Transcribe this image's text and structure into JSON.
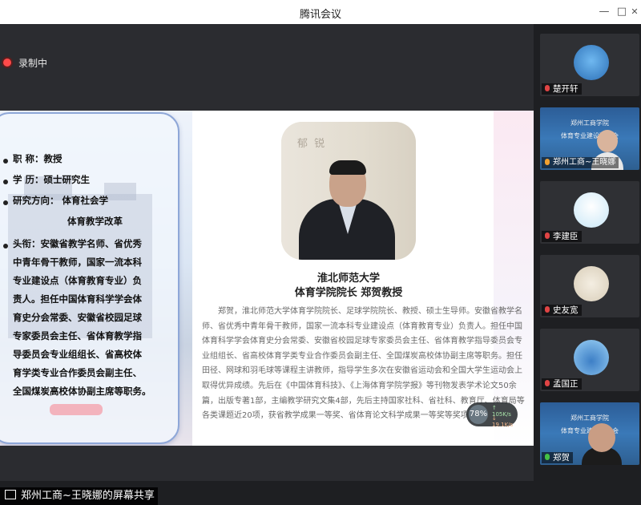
{
  "app": {
    "window_title": "腾讯会议"
  },
  "window_controls": {
    "minimize": "—",
    "maximize": "□",
    "close": "✕"
  },
  "recording": {
    "label": "录制中"
  },
  "slide": {
    "left_card": {
      "title_line": "职 称：教授",
      "degree_line": "学 历：硕士研究生",
      "research_line1": "研究方向：  体育社会学",
      "research_line2": "体育教学改革",
      "honors": [
        "头衔：安徽省教学名师、省优秀",
        "中青年骨干教师，国家一流本科",
        "专业建设点（体育教育专业）负",
        "责人。担任中国体育科学学会体",
        "育史分会常委、安徽省校园足球",
        "专家委员会主任、省体育教学指",
        "导委员会专业组组长、省高校体",
        "育学类专业合作委员会副主任、",
        "全国煤炭高校体协副主席等职务。"
      ]
    },
    "photo_calligraphy": "郁 锐",
    "university": "淮北师范大学",
    "position": "体育学院院长    郑贺教授",
    "bio": "郑贺，淮北师范大学体育学院院长、足球学院院长、教授、硕士生导师。安徽省教学名师、省优秀中青年骨干教师，国家一流本科专业建设点（体育教育专业）负责人。担任中国体育科学学会体育史分会常委、安徽省校园足球专家委员会主任、省体育教学指导委员会专业组组长、省高校体育学类专业合作委员会副主任、全国煤炭高校体协副主席等职务。担任田径、网球和羽毛球等课程主讲教师，指导学生多次在安徽省运动会和全国大学生运动会上取得优异成绩。先后在《中国体育科技》、《上海体育学院学报》等刊物发表学术论文50余篇，出版专著1部，主编教学研究文集4部，先后主持国家社科、省社科、教育厅、体育局等各类课题近20项，获省教学成果一等奖、省体育论文科学成果一等奖等奖项。"
  },
  "network_widget": {
    "percent": "78%",
    "up": "↑ 105K/s",
    "down": "↓ 19.1K/s"
  },
  "screen_share": {
    "label": "郑州工商~王晓娜的屏幕共享"
  },
  "participants": [
    {
      "name": "楚开轩",
      "mic": "muted"
    },
    {
      "name": "郑州工商~王晓娜",
      "mic": "host",
      "banner_line1": "郑州工商学院",
      "banner_line2": "体育专业建设研讨会"
    },
    {
      "name": "李建臣",
      "mic": "muted"
    },
    {
      "name": "史友宽",
      "mic": "muted"
    },
    {
      "name": "孟国正",
      "mic": "muted"
    },
    {
      "name": "郑贺",
      "mic": "on",
      "banner_line1": "郑州工商学院",
      "banner_line2": "体育专业建设研讨会"
    }
  ],
  "colors": {
    "accent_card_border": "#8ea7d8",
    "recording_dot": "#ff4a4a",
    "muted_mic": "#e04444",
    "active_mic": "#44c044"
  }
}
